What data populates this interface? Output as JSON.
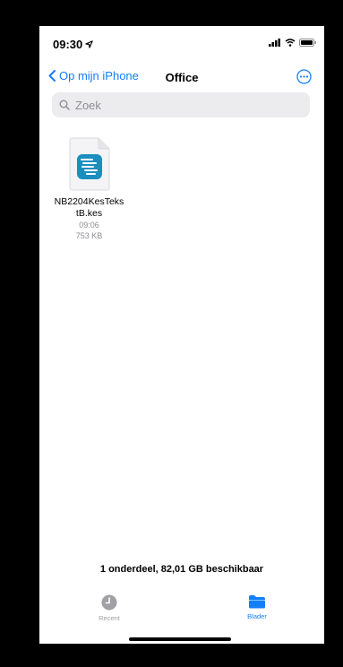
{
  "status_bar": {
    "time": "09:30",
    "icons": [
      "location-arrow-icon",
      "signal-icon",
      "wifi-icon",
      "battery-icon"
    ]
  },
  "nav": {
    "back_label": "Op mijn iPhone",
    "title": "Office",
    "more_icon": "ellipsis-circle-icon"
  },
  "search": {
    "placeholder": "Zoek"
  },
  "files": [
    {
      "name": "NB2204KesTekstB.kes",
      "time": "09:06",
      "size": "753 KB"
    }
  ],
  "footer": {
    "storage_text": "1 onderdeel, 82,01 GB beschikbaar"
  },
  "tabs": [
    {
      "label": "Recent",
      "icon": "clock-icon",
      "active": false
    },
    {
      "label": "Blader",
      "icon": "folder-icon",
      "active": true
    }
  ],
  "colors": {
    "accent": "#147efb",
    "file_icon": "#1a8fbf",
    "inactive": "#a0a0a5"
  }
}
